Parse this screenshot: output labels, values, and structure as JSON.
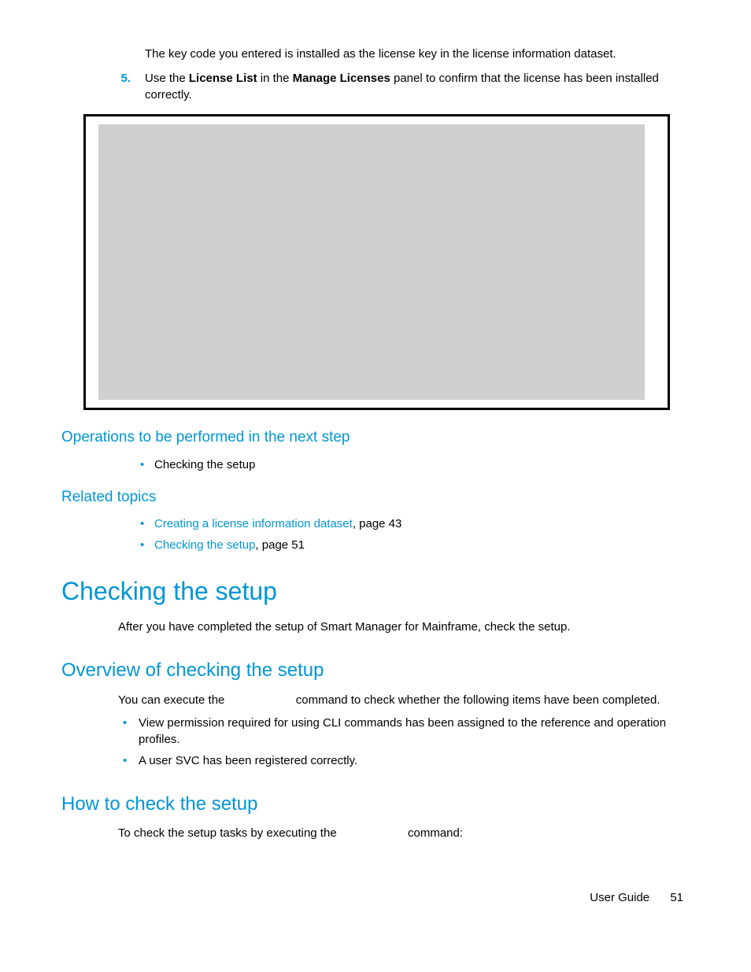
{
  "intro_text": "The key code you entered is installed as the license key in the license information dataset.",
  "step5": {
    "num": "5.",
    "pre": "Use the ",
    "bold1": "License List",
    "mid": " in the ",
    "bold2": "Manage Licenses",
    "post": " panel to confirm that the license has been installed correctly."
  },
  "ops_heading": "Operations to be performed in the next step",
  "ops_items": [
    "Checking the setup"
  ],
  "related_heading": "Related topics",
  "related": [
    {
      "link": "Creating a license information dataset",
      "suffix": ", page 43"
    },
    {
      "link": "Checking the setup",
      "suffix": ", page 51"
    }
  ],
  "h1": "Checking the setup",
  "h1_body": "After you have completed the setup of Smart Manager for Mainframe, check the setup.",
  "h2a": "Overview of checking the setup",
  "h2a_body_pre": "You can execute the ",
  "h2a_body_post": " command to check whether the following items have been completed.",
  "overview_items": [
    "View permission required for using CLI commands has been assigned to the reference and operation profiles.",
    "A user SVC has been registered correctly."
  ],
  "h2b": "How to check the setup",
  "h2b_body_pre": "To check the setup tasks by executing the ",
  "h2b_body_post": " command:",
  "footer_label": "User Guide",
  "footer_page": "51"
}
